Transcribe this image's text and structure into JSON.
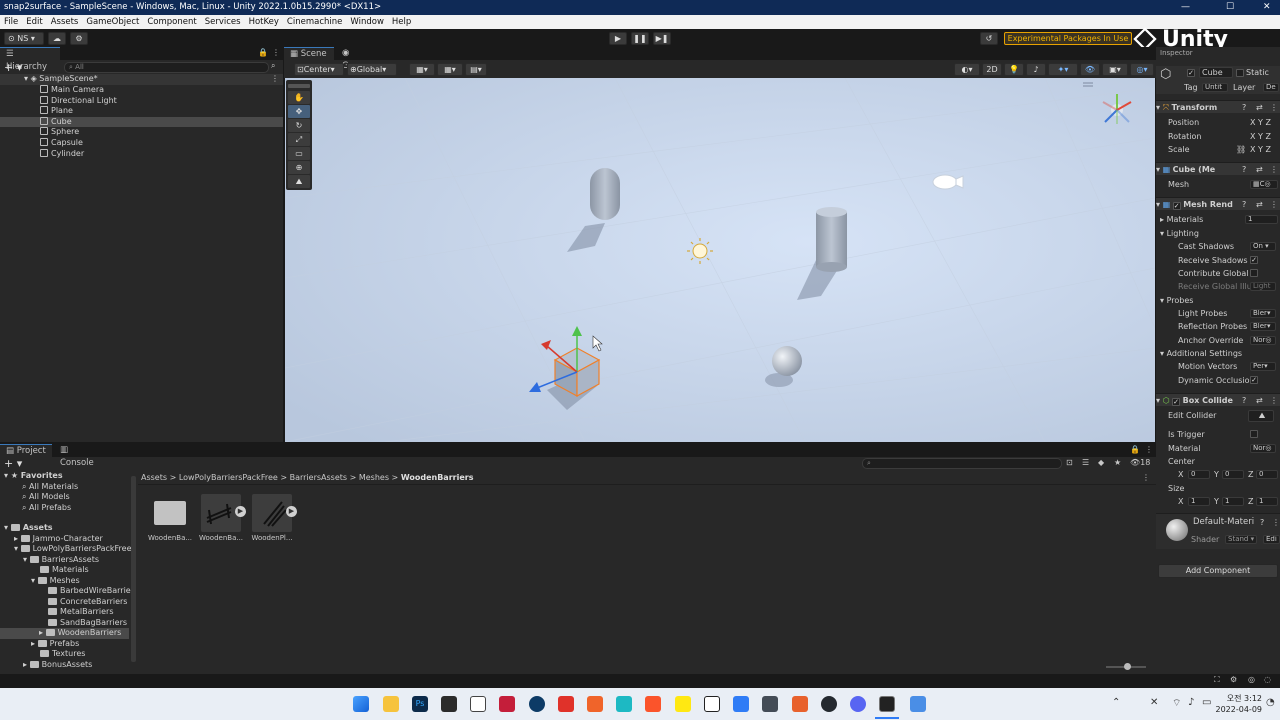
{
  "window": {
    "title": "snap2surface - SampleScene - Windows, Mac, Linux - Unity 2022.1.0b15.2990* <DX11>",
    "minimize": "—",
    "maximize": "☐",
    "close": "✕"
  },
  "menu": [
    "File",
    "Edit",
    "Assets",
    "GameObject",
    "Component",
    "Services",
    "HotKey",
    "Cinemachine",
    "Window",
    "Help"
  ],
  "toolbar": {
    "account": "NS",
    "experimental": "Experimental Packages In Use",
    "logo": "Unity",
    "play": "▶",
    "pause": "❚❚",
    "step": "▶❚"
  },
  "hierarchy": {
    "tab": "Hierarchy",
    "search_placeholder": "All",
    "scene": "SampleScene*",
    "items": [
      "Main Camera",
      "Directional Light",
      "Plane",
      "Cube",
      "Sphere",
      "Capsule",
      "Cylinder"
    ],
    "selected": "Cube"
  },
  "scene_view": {
    "tabs": [
      "Scene",
      "Game"
    ],
    "pivot": "Center",
    "space": "Global",
    "mode_2d": "2D"
  },
  "project": {
    "tabs": [
      "Project",
      "Console"
    ],
    "favorites": {
      "label": "Favorites",
      "items": [
        "All Materials",
        "All Models",
        "All Prefabs"
      ]
    },
    "assets_label": "Assets",
    "tree": [
      "Jammo-Character",
      "LowPolyBarriersPackFree",
      "BarriersAssets",
      "Materials",
      "Meshes",
      "BarbedWireBarrier",
      "ConcreteBarriers",
      "MetalBarriers",
      "SandBagBarriers",
      "WoodenBarriers",
      "Prefabs",
      "Textures",
      "BonusAssets"
    ],
    "breadcrumb": [
      "Assets",
      "LowPolyBarriersPackFree",
      "BarriersAssets",
      "Meshes",
      "WoodenBarriers"
    ],
    "files": [
      "WoodenBa...",
      "WoodenBa...",
      "WoodenPl..."
    ],
    "hidden_count": "18"
  },
  "inspector": {
    "tab": "Inspector",
    "object_name": "Cube",
    "static_label": "Static",
    "tag_label": "Tag",
    "tag_value": "Untit",
    "layer_label": "Layer",
    "layer_value": "De",
    "transform": {
      "title": "Transform",
      "rows": [
        "Position",
        "Rotation",
        "Scale"
      ],
      "axes": [
        "X",
        "Y",
        "Z"
      ]
    },
    "mesh_filter": {
      "title": "Cube (Me",
      "mesh_label": "Mesh",
      "mesh_value": "C"
    },
    "mesh_renderer": {
      "title": "Mesh Rend",
      "materials_label": "Materials",
      "materials_value": "1",
      "lighting": "Lighting",
      "cast_shadows": "Cast Shadows",
      "cast_shadows_value": "On",
      "receive_shadows": "Receive Shadows",
      "contribute_gi": "Contribute Global I",
      "receive_gi": "Receive Global Illu",
      "receive_gi_value": "Light",
      "probes": "Probes",
      "light_probes": "Light Probes",
      "light_probes_value": "Bler",
      "reflection_probes": "Reflection Probes",
      "reflection_probes_value": "Bler",
      "anchor_override": "Anchor Override",
      "anchor_override_value": "Nor",
      "additional": "Additional Settings",
      "motion_vectors": "Motion Vectors",
      "motion_vectors_value": "Per",
      "dynamic_occlusion": "Dynamic Occlusio"
    },
    "box_collider": {
      "title": "Box Collide",
      "edit_collider": "Edit Collider",
      "is_trigger": "Is Trigger",
      "material": "Material",
      "material_value": "Nor",
      "center": "Center",
      "center_values": [
        "0",
        "0",
        "0"
      ],
      "size": "Size",
      "size_values": [
        "1",
        "1",
        "1"
      ]
    },
    "material": {
      "name": "Default-Materi",
      "shader_label": "Shader",
      "shader_value": "Stand",
      "edit": "Edi"
    },
    "add_component": "Add Component"
  },
  "taskbar": {
    "lang": "오전",
    "time": "3:12",
    "date": "2022-04-09"
  },
  "colors": {
    "accent": "#3a79bb",
    "scene_sky": "#c9d6ea",
    "experimental": "#e8a200",
    "title_bg": "#0f2a56"
  }
}
